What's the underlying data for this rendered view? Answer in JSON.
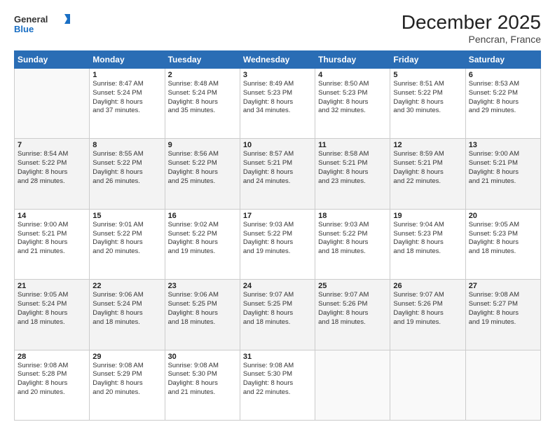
{
  "header": {
    "logo_line1": "General",
    "logo_line2": "Blue",
    "title": "December 2025",
    "subtitle": "Pencran, France"
  },
  "days_of_week": [
    "Sunday",
    "Monday",
    "Tuesday",
    "Wednesday",
    "Thursday",
    "Friday",
    "Saturday"
  ],
  "weeks": [
    [
      {
        "num": "",
        "info": ""
      },
      {
        "num": "1",
        "info": "Sunrise: 8:47 AM\nSunset: 5:24 PM\nDaylight: 8 hours\nand 37 minutes."
      },
      {
        "num": "2",
        "info": "Sunrise: 8:48 AM\nSunset: 5:24 PM\nDaylight: 8 hours\nand 35 minutes."
      },
      {
        "num": "3",
        "info": "Sunrise: 8:49 AM\nSunset: 5:23 PM\nDaylight: 8 hours\nand 34 minutes."
      },
      {
        "num": "4",
        "info": "Sunrise: 8:50 AM\nSunset: 5:23 PM\nDaylight: 8 hours\nand 32 minutes."
      },
      {
        "num": "5",
        "info": "Sunrise: 8:51 AM\nSunset: 5:22 PM\nDaylight: 8 hours\nand 30 minutes."
      },
      {
        "num": "6",
        "info": "Sunrise: 8:53 AM\nSunset: 5:22 PM\nDaylight: 8 hours\nand 29 minutes."
      }
    ],
    [
      {
        "num": "7",
        "info": "Sunrise: 8:54 AM\nSunset: 5:22 PM\nDaylight: 8 hours\nand 28 minutes."
      },
      {
        "num": "8",
        "info": "Sunrise: 8:55 AM\nSunset: 5:22 PM\nDaylight: 8 hours\nand 26 minutes."
      },
      {
        "num": "9",
        "info": "Sunrise: 8:56 AM\nSunset: 5:22 PM\nDaylight: 8 hours\nand 25 minutes."
      },
      {
        "num": "10",
        "info": "Sunrise: 8:57 AM\nSunset: 5:21 PM\nDaylight: 8 hours\nand 24 minutes."
      },
      {
        "num": "11",
        "info": "Sunrise: 8:58 AM\nSunset: 5:21 PM\nDaylight: 8 hours\nand 23 minutes."
      },
      {
        "num": "12",
        "info": "Sunrise: 8:59 AM\nSunset: 5:21 PM\nDaylight: 8 hours\nand 22 minutes."
      },
      {
        "num": "13",
        "info": "Sunrise: 9:00 AM\nSunset: 5:21 PM\nDaylight: 8 hours\nand 21 minutes."
      }
    ],
    [
      {
        "num": "14",
        "info": "Sunrise: 9:00 AM\nSunset: 5:21 PM\nDaylight: 8 hours\nand 21 minutes."
      },
      {
        "num": "15",
        "info": "Sunrise: 9:01 AM\nSunset: 5:22 PM\nDaylight: 8 hours\nand 20 minutes."
      },
      {
        "num": "16",
        "info": "Sunrise: 9:02 AM\nSunset: 5:22 PM\nDaylight: 8 hours\nand 19 minutes."
      },
      {
        "num": "17",
        "info": "Sunrise: 9:03 AM\nSunset: 5:22 PM\nDaylight: 8 hours\nand 19 minutes."
      },
      {
        "num": "18",
        "info": "Sunrise: 9:03 AM\nSunset: 5:22 PM\nDaylight: 8 hours\nand 18 minutes."
      },
      {
        "num": "19",
        "info": "Sunrise: 9:04 AM\nSunset: 5:23 PM\nDaylight: 8 hours\nand 18 minutes."
      },
      {
        "num": "20",
        "info": "Sunrise: 9:05 AM\nSunset: 5:23 PM\nDaylight: 8 hours\nand 18 minutes."
      }
    ],
    [
      {
        "num": "21",
        "info": "Sunrise: 9:05 AM\nSunset: 5:24 PM\nDaylight: 8 hours\nand 18 minutes."
      },
      {
        "num": "22",
        "info": "Sunrise: 9:06 AM\nSunset: 5:24 PM\nDaylight: 8 hours\nand 18 minutes."
      },
      {
        "num": "23",
        "info": "Sunrise: 9:06 AM\nSunset: 5:25 PM\nDaylight: 8 hours\nand 18 minutes."
      },
      {
        "num": "24",
        "info": "Sunrise: 9:07 AM\nSunset: 5:25 PM\nDaylight: 8 hours\nand 18 minutes."
      },
      {
        "num": "25",
        "info": "Sunrise: 9:07 AM\nSunset: 5:26 PM\nDaylight: 8 hours\nand 18 minutes."
      },
      {
        "num": "26",
        "info": "Sunrise: 9:07 AM\nSunset: 5:26 PM\nDaylight: 8 hours\nand 19 minutes."
      },
      {
        "num": "27",
        "info": "Sunrise: 9:08 AM\nSunset: 5:27 PM\nDaylight: 8 hours\nand 19 minutes."
      }
    ],
    [
      {
        "num": "28",
        "info": "Sunrise: 9:08 AM\nSunset: 5:28 PM\nDaylight: 8 hours\nand 20 minutes."
      },
      {
        "num": "29",
        "info": "Sunrise: 9:08 AM\nSunset: 5:29 PM\nDaylight: 8 hours\nand 20 minutes."
      },
      {
        "num": "30",
        "info": "Sunrise: 9:08 AM\nSunset: 5:30 PM\nDaylight: 8 hours\nand 21 minutes."
      },
      {
        "num": "31",
        "info": "Sunrise: 9:08 AM\nSunset: 5:30 PM\nDaylight: 8 hours\nand 22 minutes."
      },
      {
        "num": "",
        "info": ""
      },
      {
        "num": "",
        "info": ""
      },
      {
        "num": "",
        "info": ""
      }
    ]
  ]
}
